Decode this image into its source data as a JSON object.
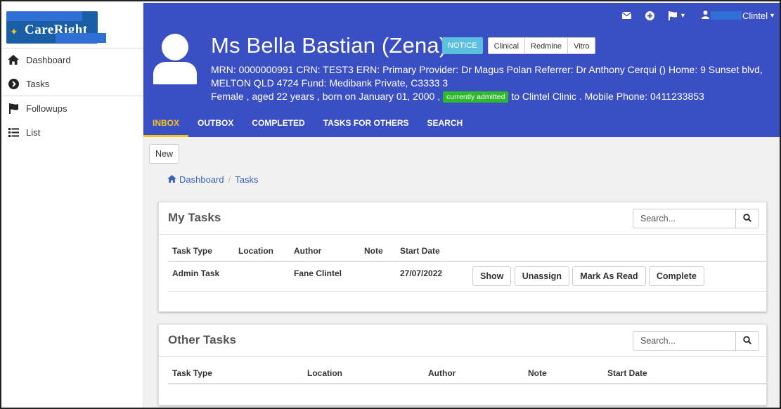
{
  "sidebar": {
    "logo_text": "CareRight",
    "items": [
      {
        "label": "Dashboard",
        "icon": "home-icon"
      },
      {
        "label": "Tasks",
        "icon": "chevron-circle-right-icon"
      },
      {
        "label": "Followups",
        "icon": "flag-icon"
      },
      {
        "label": "List",
        "icon": "list-icon"
      }
    ]
  },
  "topbar": {
    "user_name": "Clintel"
  },
  "patient": {
    "name": "Ms Bella Bastian (Zena)",
    "badges": {
      "notice": "NOTICE",
      "clinical": "Clinical",
      "redmine": "Redmine",
      "vitro": "Vitro"
    },
    "line1": "MRN: 0000000991   CRN: TEST3   ERN:    Primary Provider: Dr Magus Polan   Referrer: Dr Anthony Cerqui ()   Home: 9 Sunset blvd,",
    "line2": "MELTON QLD 4724   Fund: Medibank Private, C3333 3",
    "line3_pre": "Female , aged 22 years , born on January 01, 2000 ,",
    "admitted_badge": "currently admitted",
    "line3_post": "to Clintel Clinic . Mobile Phone: 0411233853"
  },
  "tabs": [
    "INBOX",
    "OUTBOX",
    "COMPLETED",
    "TASKS FOR OTHERS",
    "SEARCH"
  ],
  "main": {
    "new_button": "New",
    "breadcrumb": [
      "Dashboard",
      "Tasks"
    ]
  },
  "my_tasks": {
    "title": "My Tasks",
    "search_placeholder": "Search...",
    "columns": [
      "Task Type",
      "Location",
      "Author",
      "Note",
      "Start Date"
    ],
    "rows": [
      {
        "task_type": "Admin Task",
        "location": "",
        "author": "Fane Clintel",
        "note": "",
        "start_date": "27/07/2022"
      }
    ],
    "actions": [
      "Show",
      "Unassign",
      "Mark As Read",
      "Complete"
    ]
  },
  "other_tasks": {
    "title": "Other Tasks",
    "search_placeholder": "Search...",
    "columns": [
      "Task Type",
      "Location",
      "Author",
      "Note",
      "Start Date"
    ]
  },
  "colors": {
    "header_bg": "#3b4fc4",
    "active_tab": "#f5c518",
    "notice_badge": "#5bc0de",
    "admitted_badge": "#2eb82e",
    "link": "#3a63b8"
  }
}
